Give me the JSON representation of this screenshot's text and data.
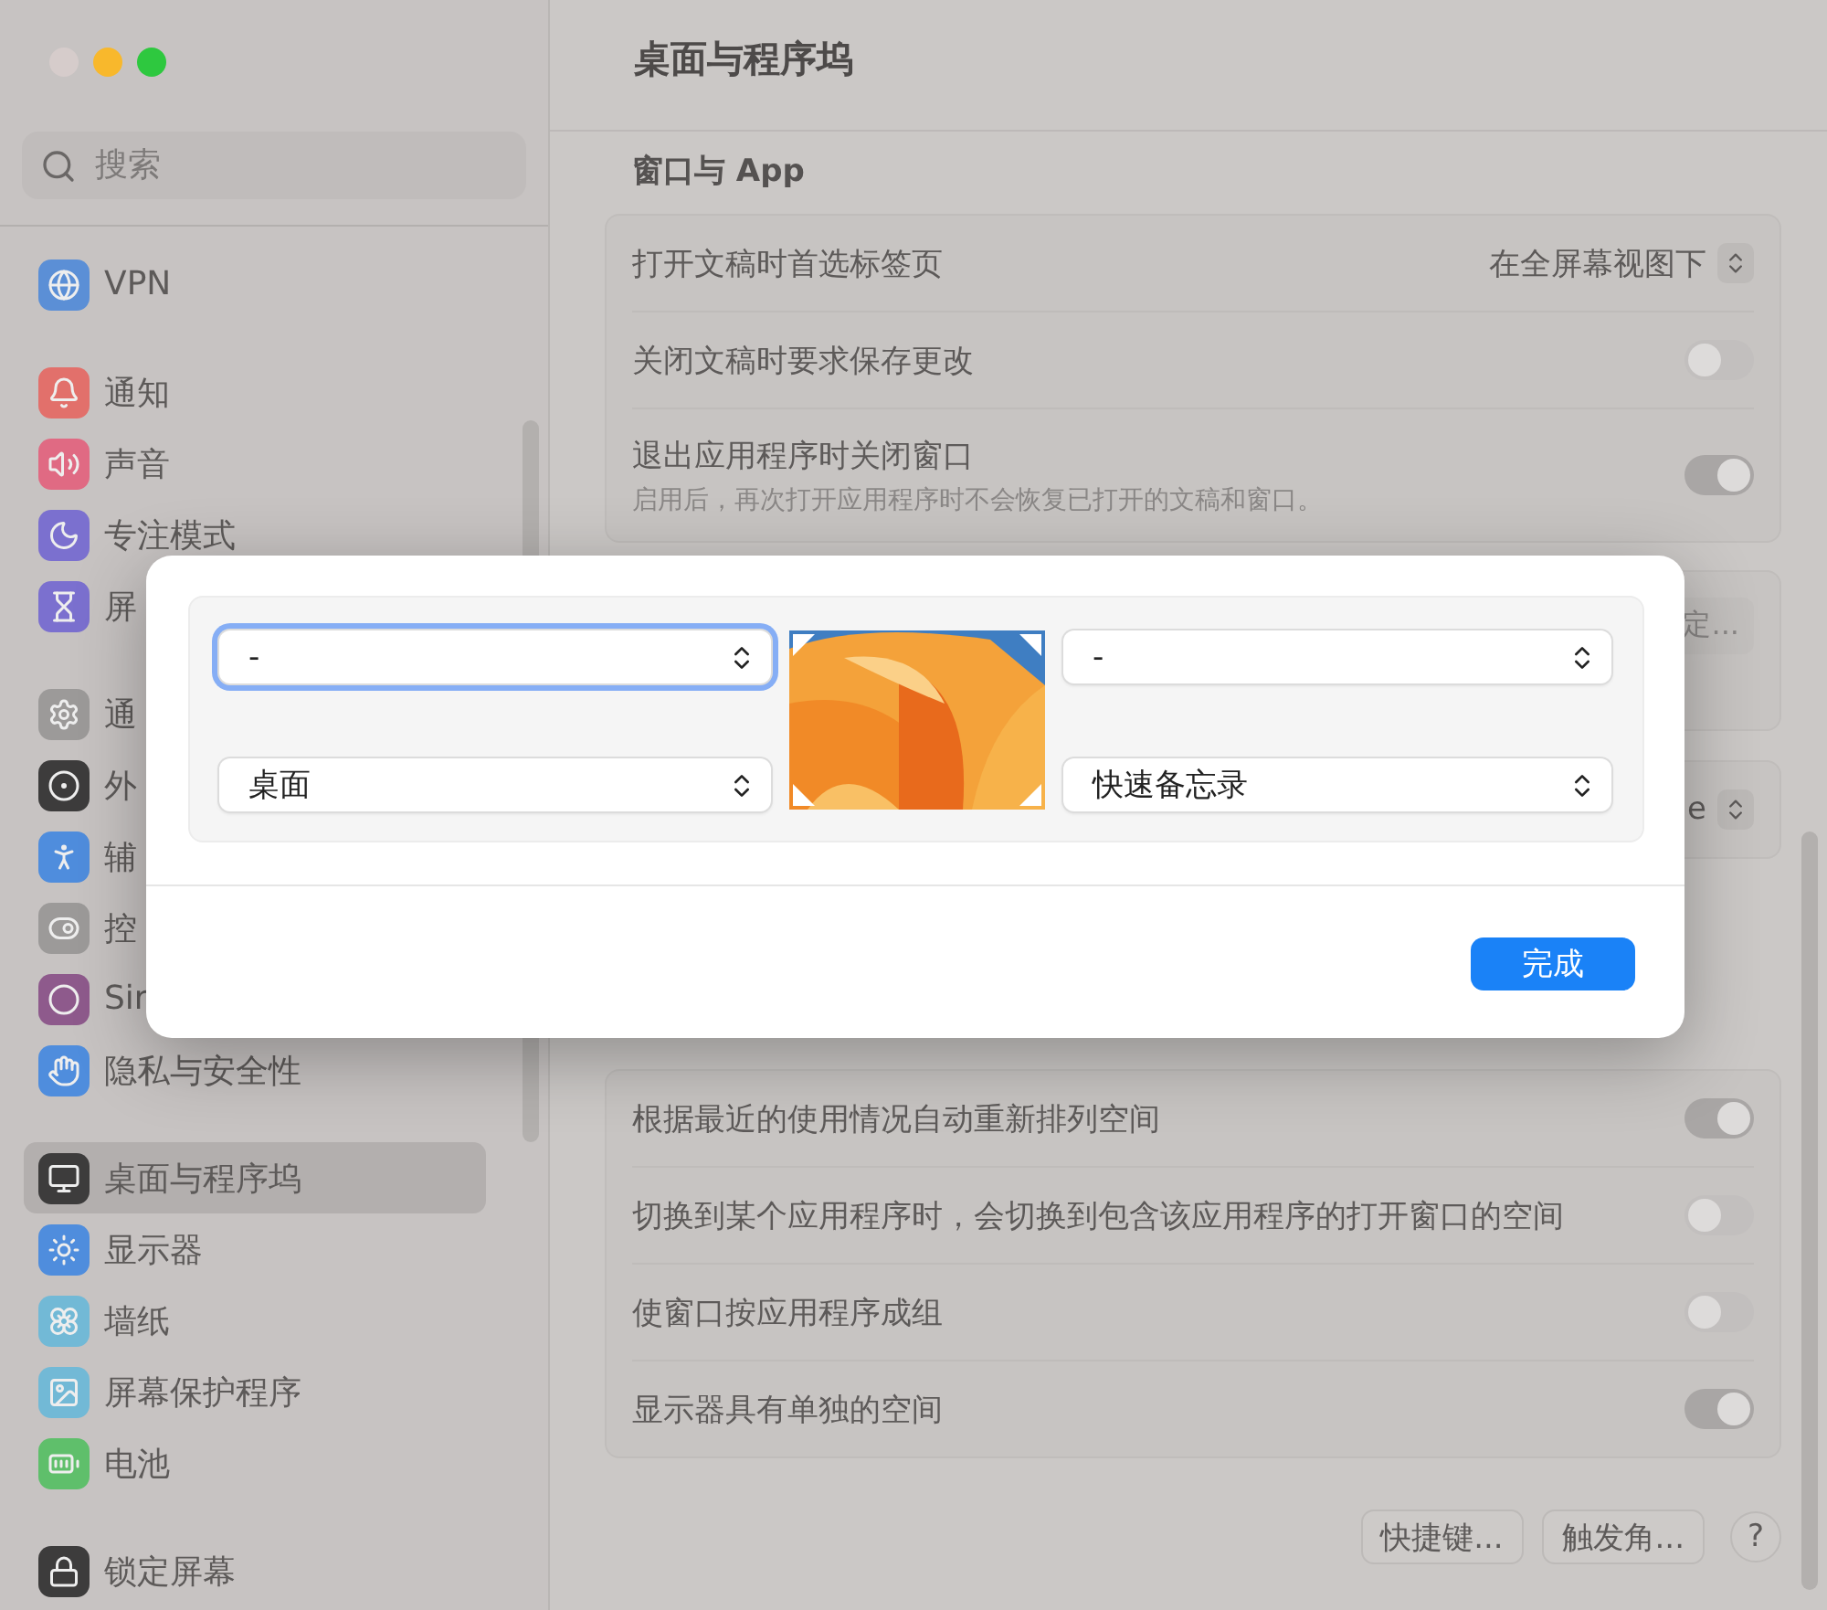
{
  "window": {
    "title": "桌面与程序坞"
  },
  "sidebar": {
    "search": {
      "placeholder": "搜索"
    },
    "groups": [
      {
        "items": [
          {
            "label": "VPN",
            "color": "#5b8fd6",
            "selected": false
          }
        ]
      },
      {
        "items": [
          {
            "label": "通知",
            "color": "#e2706b",
            "selected": false
          },
          {
            "label": "声音",
            "color": "#e06a83",
            "selected": false
          },
          {
            "label": "专注模式",
            "color": "#7b70cf",
            "selected": false
          },
          {
            "label": "屏",
            "color": "#7b70cf",
            "selected": false
          }
        ]
      },
      {
        "items": [
          {
            "label": "通",
            "color": "#9c9a99",
            "selected": false
          },
          {
            "label": "外",
            "color": "#3d3c3c",
            "selected": false
          },
          {
            "label": "辅",
            "color": "#4f8ddd",
            "selected": false
          },
          {
            "label": "控",
            "color": "#9c9a99",
            "selected": false
          },
          {
            "label": "Sir",
            "color": "#8e5a8c",
            "selected": false
          },
          {
            "label": "隐私与安全性",
            "color": "#4f8ddd",
            "selected": false
          }
        ]
      },
      {
        "items": [
          {
            "label": "桌面与程序坞",
            "color": "#3d3c3c",
            "selected": true
          },
          {
            "label": "显示器",
            "color": "#4f8ddd",
            "selected": false
          },
          {
            "label": "墙纸",
            "color": "#72b9d6",
            "selected": false
          },
          {
            "label": "屏幕保护程序",
            "color": "#72b9d6",
            "selected": false
          },
          {
            "label": "电池",
            "color": "#5fbf6b",
            "selected": false
          }
        ]
      },
      {
        "items": [
          {
            "label": "锁定屏幕",
            "color": "#3d3c3c",
            "selected": false
          }
        ]
      }
    ]
  },
  "main": {
    "section_title": "窗口与 App",
    "window_settings": [
      {
        "kind": "popup",
        "label": "打开文稿时首选标签页",
        "value": "在全屏幕视图下"
      },
      {
        "kind": "toggle",
        "label": "关闭文稿时要求保存更改",
        "on": false
      },
      {
        "kind": "toggle",
        "label": "退出应用程序时关闭窗口",
        "description": "启用后，再次打开应用程序时不会恢复已打开的文稿和窗口。",
        "on": true
      }
    ],
    "partial_button": "定...",
    "partial_value": "e",
    "spaces_settings": [
      {
        "kind": "toggle",
        "label": "根据最近的使用情况自动重新排列空间",
        "on": true
      },
      {
        "kind": "toggle",
        "label": "切换到某个应用程序时，会切换到包含该应用程序的打开窗口的空间",
        "on": false
      },
      {
        "kind": "toggle",
        "label": "使窗口按应用程序成组",
        "on": false
      },
      {
        "kind": "toggle",
        "label": "显示器具有单独的空间",
        "on": true
      }
    ],
    "footer_buttons": [
      "快捷键...",
      "触发角..."
    ],
    "help_button": "?"
  },
  "hot_corners_dialog": {
    "corners": [
      {
        "value": "-",
        "focused": true
      },
      {
        "value": "-",
        "focused": false
      },
      {
        "value": "桌面",
        "focused": false
      },
      {
        "value": "快速备忘录",
        "focused": false
      }
    ],
    "done_button": "完成"
  }
}
